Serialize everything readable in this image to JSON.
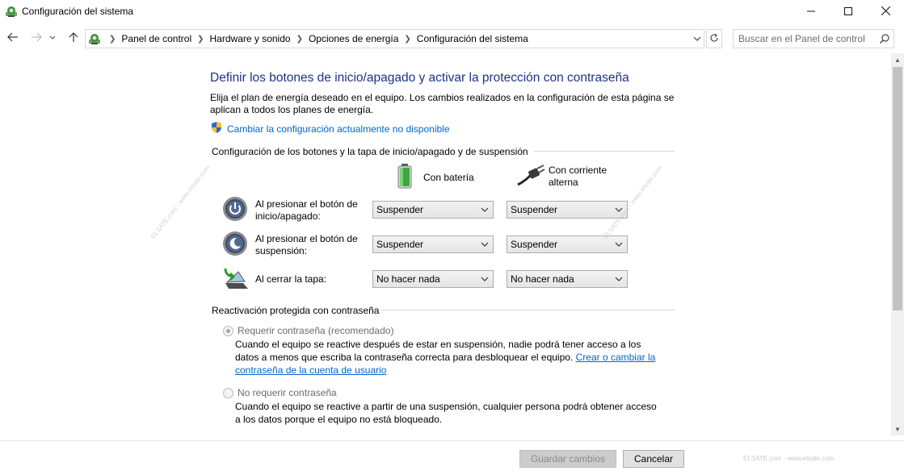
{
  "window": {
    "title": "Configuración del sistema",
    "minimize_icon": "minimize-icon",
    "maximize_icon": "maximize-icon",
    "close_icon": "close-icon"
  },
  "nav": {
    "back_icon": "arrow-left-icon",
    "forward_icon": "arrow-right-icon",
    "recent_icon": "chevron-down-icon",
    "up_icon": "arrow-up-icon",
    "breadcrumbs": [
      "Panel de control",
      "Hardware y sonido",
      "Opciones de energía",
      "Configuración del sistema"
    ],
    "refresh_icon": "refresh-icon",
    "search_placeholder": "Buscar en el Panel de control"
  },
  "page": {
    "heading": "Definir los botones de inicio/apagado y activar la protección con contraseña",
    "description": "Elija el plan de energía deseado en el equipo. Los cambios realizados en la configuración de esta página se aplican a todos los planes de energía.",
    "change_link": "Cambiar la configuración actualmente no disponible"
  },
  "buttons_section": {
    "title": "Configuración de los botones y la tapa de inicio/apagado y de suspensión",
    "col_battery": "Con batería",
    "col_ac": "Con corriente alterna",
    "rows": [
      {
        "label": "Al presionar el botón de inicio/apagado:",
        "battery": "Suspender",
        "ac": "Suspender",
        "icon": "power-button-icon"
      },
      {
        "label": "Al presionar el botón de suspensión:",
        "battery": "Suspender",
        "ac": "Suspender",
        "icon": "sleep-button-icon"
      },
      {
        "label": "Al cerrar la tapa:",
        "battery": "No hacer nada",
        "ac": "No hacer nada",
        "icon": "laptop-lid-icon"
      }
    ]
  },
  "password_section": {
    "title": "Reactivación protegida con contraseña",
    "require": {
      "label": "Requerir contraseña (recomendado)",
      "checked": true,
      "desc": "Cuando el equipo se reactive después de estar en suspensión, nadie podrá tener acceso a los datos a menos que escriba la contraseña correcta para desbloquear el equipo.",
      "link": "Crear o cambiar la contraseña de la cuenta de usuario"
    },
    "no_require": {
      "label": "No requerir contraseña",
      "checked": false,
      "desc": "Cuando el equipo se reactive a partir de una suspensión, cualquier persona podrá obtener acceso a los datos porque el equipo no está bloqueado."
    }
  },
  "footer": {
    "save": "Guardar cambios",
    "cancel": "Cancelar",
    "watermark": "ELSATE.com - www.elsate.com"
  },
  "colors": {
    "heading": "#1e3287",
    "link": "#0066cc",
    "disabled_text": "#6d6d6d"
  }
}
